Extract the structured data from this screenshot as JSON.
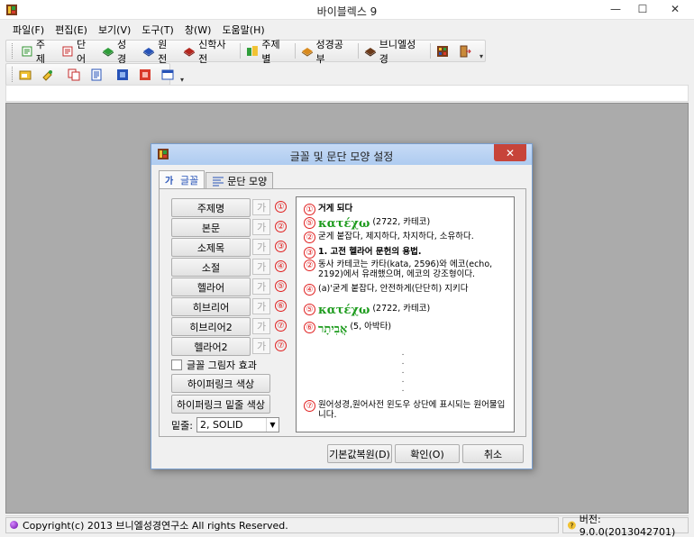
{
  "window": {
    "title": "바이블렉스 9",
    "min_glyph": "—",
    "max_glyph": "☐",
    "close_glyph": "✕"
  },
  "menu": [
    "파일(F)",
    "편집(E)",
    "보기(V)",
    "도구(T)",
    "창(W)",
    "도움말(H)"
  ],
  "toolbar1": [
    "주제",
    "단어",
    "성경",
    "원전",
    "신학사전",
    "주제별",
    "성경공부",
    "브니엘성경"
  ],
  "status": {
    "copyright": "Copyright(c) 2013 브니엘성경연구소 All rights Reserved.",
    "version": "버전: 9.0.0(2013042701)"
  },
  "dialog": {
    "title": "글꼴 및 문단 모양 설정",
    "close_glyph": "✕",
    "tabs": [
      "글꼴",
      "문단 모양"
    ],
    "font_buttons": [
      "주제명",
      "본문",
      "소제목",
      "소절",
      "헬라어",
      "히브리어",
      "히브리어2",
      "헬라어2"
    ],
    "sample_glyph": "가",
    "circle_numbers": [
      "①",
      "②",
      "③",
      "④",
      "⑤",
      "⑥",
      "⑦",
      "⑦"
    ],
    "shadow_label": "글꼴 그림자 효과",
    "hyperlink_color": "하이퍼링크 색상",
    "hyperlink_underline_color": "하이퍼링크 밑줄 색상",
    "underline_label": "밑줄:",
    "underline_value": "2, SOLID",
    "preview": {
      "p1_num": "①",
      "p1": "거게 되다",
      "p5_num": "⑤",
      "p5_greek": "κατέχω",
      "p5_rest": "(2722, 카테코)",
      "p2_num": "②",
      "p2": "굳게 붙잡다, 제지하다, 차지하다, 소유하다.",
      "p3_num": "③",
      "p3": "1. 고전 헬라어 문헌의 용법.",
      "p2b_num": "②",
      "p2b": "동사 카테코는 카타(kata, 2596)와 에코(echo, 2192)에서 유래했으며, 에코의 강조형이다.",
      "p4_num": "④",
      "p4": "(a)'굳게 붙잡다, 안전하게(단단히) 지키다",
      "p5b_num": "⑤",
      "p5b_greek": "κατέχω",
      "p5b_rest": "(2722, 카테코)",
      "p6_num": "⑥",
      "p6_hebrew": "אֲבִיתָר",
      "p6_rest": "(5, 아박타)",
      "dots": ".\n.\n.\n.\n.",
      "p7_num": "⑦",
      "p7": "원어성경,원어사전 윈도우 상단에 표시되는 원어물입니다."
    },
    "buttons": {
      "reset": "기본값복원(D)",
      "ok": "확인(O)",
      "cancel": "취소"
    }
  }
}
